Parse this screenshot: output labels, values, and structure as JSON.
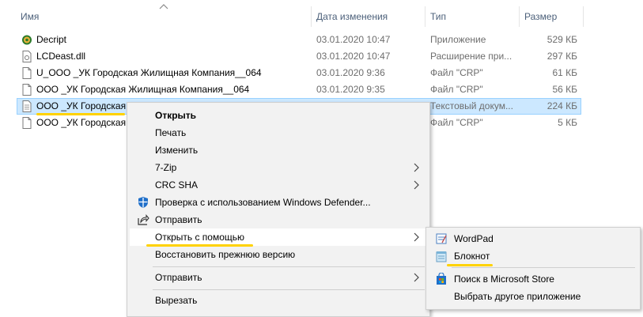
{
  "columns": {
    "name": "Имя",
    "date": "Дата изменения",
    "type": "Тип",
    "size": "Размер"
  },
  "files": [
    {
      "name": "Decript",
      "date": "03.01.2020 10:47",
      "type": "Приложение",
      "size": "529 КБ",
      "icon": "app-gear-icon"
    },
    {
      "name": "LCDeast.dll",
      "date": "03.01.2020 10:47",
      "type": "Расширение при...",
      "size": "297 КБ",
      "icon": "dll-file-icon"
    },
    {
      "name": "U_ООО _УК Городская Жилищная Компания__064",
      "date": "03.01.2020 9:36",
      "type": "Файл \"CRP\"",
      "size": "61 КБ",
      "icon": "file-icon"
    },
    {
      "name": "ООО _УК Городская Жилищная Компания__064",
      "date": "03.01.2020 9:35",
      "type": "Файл \"CRP\"",
      "size": "56 КБ",
      "icon": "file-icon"
    },
    {
      "name": "ООО _УК Городская Ж",
      "date": "",
      "type": "Текстовый докум...",
      "size": "224 КБ",
      "icon": "text-file-icon"
    },
    {
      "name": "ООО _УК Городская Ж",
      "date": "",
      "type": "Файл \"CRP\"",
      "size": "5 КБ",
      "icon": "file-icon"
    }
  ],
  "context_menu": {
    "open": "Открыть",
    "print": "Печать",
    "edit": "Изменить",
    "zip": "7-Zip",
    "crc": "CRC SHA",
    "defender": "Проверка с использованием Windows Defender...",
    "share": "Отправить",
    "open_with": "Открыть с помощью",
    "restore": "Восстановить прежнюю версию",
    "send_to": "Отправить",
    "cut": "Вырезать"
  },
  "submenu": {
    "wordpad": "WordPad",
    "notepad": "Блокнот",
    "store": "Поиск в Microsoft Store",
    "other": "Выбрать другое приложение"
  },
  "colors": {
    "selection": "#cce8ff",
    "highlight_underline": "#ffd200",
    "header_text": "#4c607a"
  }
}
